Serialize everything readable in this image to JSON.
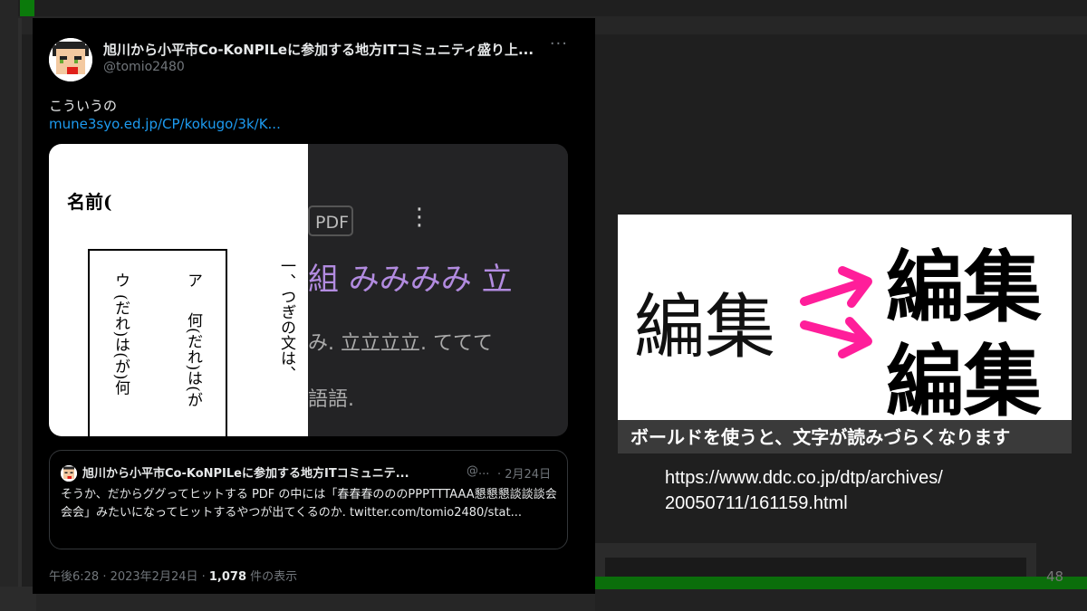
{
  "tweet": {
    "display_name": "旭川から小平市Co-KoNPILeに参加する地方ITコミュニティ盛り上...",
    "handle": "@tomio2480",
    "more_icon": "more-horizontal-icon",
    "text": "こういうの",
    "link": "mune3syo.ed.jp/CP/kokugo/3k/K...",
    "media": {
      "doc_title": "名前(",
      "col_a_mark": "ア",
      "col_a_text": "何(だれ)は(が",
      "col_u_mark": "ウ",
      "col_u_text": "(だれ)は(が)何",
      "col_q_text": "一、つぎの文は、",
      "pdf_badge": "PDF",
      "purple_text": "組 みみみみ 立",
      "gray_text_1": "み. 立立立立. ててて",
      "gray_text_2": "語語."
    },
    "quote": {
      "display_name": "旭川から小平市Co-KoNPILeに参加する地方ITコミュニテ...",
      "handle": "@...",
      "date": "· 2月24日",
      "text": "そうか、だからググってヒットする PDF の中には「春春春のののPPPTTTAAA懇懇懇談談談会会会」みたいになってヒットするやつが出てくるのか. twitter.com/tomio2480/stat..."
    },
    "meta_prefix": "午後6:28 · 2023年2月24日 · ",
    "views_count": "1,078",
    "views_label": " 件の表示"
  },
  "figure": {
    "light_text": "編集",
    "bold_text_1": "編集",
    "bold_text_2": "編集",
    "arrow_color": "#ff1e9a",
    "caption": "ボールドを使うと、文字が読みづらくなります"
  },
  "source_url_line1": "https://www.ddc.co.jp/dtp/archives/",
  "source_url_line2": "20050711/161159.html",
  "page_number": "48"
}
